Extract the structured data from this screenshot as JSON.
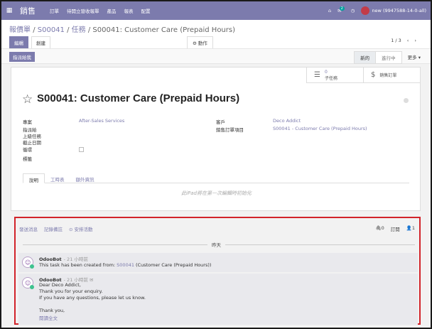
{
  "topbar": {
    "app_title": "銷售",
    "menu": [
      "訂單",
      "待開立發收報單",
      "產品",
      "報表",
      "配置"
    ],
    "chat_badge": "2",
    "user": "new (9947588-14-0-all)"
  },
  "breadcrumb": {
    "part1": "報價單",
    "part2": "S00041",
    "part3": "任務",
    "current": "S00041: Customer Care (Prepaid Hours)",
    "sep": "/"
  },
  "buttons": {
    "edit": "編輯",
    "create": "創建",
    "actions": "⚙ 動作",
    "assign": "指派給我"
  },
  "pager": {
    "value": "1 / 3"
  },
  "stages": {
    "new": "新的",
    "in_progress": "進行中",
    "more": "更多 ▾"
  },
  "smart_buttons": {
    "subtasks_count": "0",
    "subtasks_label": "子任務",
    "sales_order_label": "銷售訂單"
  },
  "record": {
    "title": "S00041: Customer Care (Prepaid Hours)"
  },
  "fields": {
    "project_label": "專案",
    "project_value": "After-Sales Services",
    "assignee_label": "指派給",
    "parent_label": "上級任務",
    "deadline_label": "截止日期",
    "recurring_label": "循環",
    "tags_label": "標籤",
    "customer_label": "客戶",
    "customer_value": "Deco Addict",
    "so_item_label": "銷售訂單項目",
    "so_item_value": "S00041 - Customer Care (Prepaid Hours)"
  },
  "tabs": [
    "說明",
    "工時表",
    "額外資訊"
  ],
  "description_placeholder": "此iPad將在第一次編輯時初始化",
  "chatter": {
    "send_message": "發送消息",
    "log_note": "記錄備註",
    "schedule_activity": "⊙ 安排活動",
    "attachments": "0",
    "follow": "訂閱",
    "followers": "1",
    "date_divider": "昨天",
    "messages": [
      {
        "author": "OdooBot",
        "time": "- 21 小時前",
        "line1_prefix": "This task has been created from: ",
        "line1_link": "S00041",
        "line1_suffix": " (Customer Care (Prepaid Hours))"
      },
      {
        "author": "OdooBot",
        "time": "- 21 小時前  ✉",
        "lines": [
          "Dear Deco Addict,",
          "Thank you for your enquiry.",
          "If you have any questions, please let us know.",
          "",
          "Thank you,"
        ],
        "more": "閱讀全文"
      }
    ]
  },
  "colors": {
    "brand": "#7c7bad",
    "highlight": "#d2232a"
  }
}
